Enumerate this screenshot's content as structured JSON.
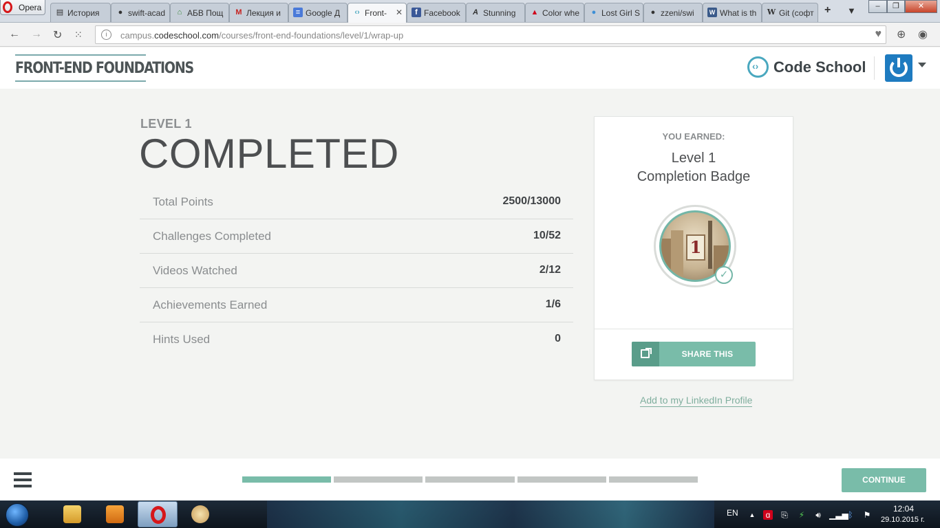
{
  "browser": {
    "menu_label": "Opera",
    "tabs": [
      {
        "icon": "history-icon",
        "title": "История",
        "active": false
      },
      {
        "icon": "github-icon",
        "title": "swift-acad",
        "active": false
      },
      {
        "icon": "home-icon",
        "title": "АБВ Пощ",
        "active": false
      },
      {
        "icon": "gmail-icon",
        "title": "Лекция и",
        "active": false
      },
      {
        "icon": "google-docs-icon",
        "title": "Google Д",
        "active": false
      },
      {
        "icon": "codeschool-icon",
        "title": "Front-",
        "active": true
      },
      {
        "icon": "facebook-icon",
        "title": "Facebook",
        "active": false
      },
      {
        "icon": "awwwards-icon",
        "title": "Stunning",
        "active": false
      },
      {
        "icon": "adobe-icon",
        "title": "Color whe",
        "active": false
      },
      {
        "icon": "droplet-icon",
        "title": "Lost Girl S",
        "active": false
      },
      {
        "icon": "github-icon",
        "title": "zzeni/swi",
        "active": false
      },
      {
        "icon": "w3schools-icon",
        "title": "What is th",
        "active": false
      },
      {
        "icon": "wikipedia-icon",
        "title": "Git (софт",
        "active": false
      }
    ],
    "url_prefix": "campus.",
    "url_domain": "codeschool.com",
    "url_path": "/courses/front-end-foundations/level/1/wrap-up"
  },
  "header": {
    "course_logo": "FRONT-END FOUNDATIONS",
    "brand": "Code School"
  },
  "main": {
    "level_label": "LEVEL 1",
    "status": "COMPLETED",
    "stats": [
      {
        "label": "Total Points",
        "value": "2500/13000"
      },
      {
        "label": "Challenges Completed",
        "value": "10/52"
      },
      {
        "label": "Videos Watched",
        "value": "2/12"
      },
      {
        "label": "Achievements Earned",
        "value": "1/6"
      },
      {
        "label": "Hints Used",
        "value": "0"
      }
    ]
  },
  "badge": {
    "earned_label": "YOU EARNED:",
    "name_line1": "Level 1",
    "name_line2": "Completion Badge",
    "number": "1",
    "share_label": "SHARE THIS",
    "linkedin_label": "Add to my LinkedIn Profile"
  },
  "footer": {
    "progress_segments": 5,
    "progress_completed": 1,
    "continue_label": "CONTINUE"
  },
  "taskbar": {
    "language": "EN",
    "time": "12:04",
    "date": "29.10.2015 г."
  },
  "colors": {
    "accent": "#79bca9",
    "accent_dark": "#5a9d8a",
    "brand_blue": "#1e7bc0",
    "background": "#f3f4f2"
  }
}
